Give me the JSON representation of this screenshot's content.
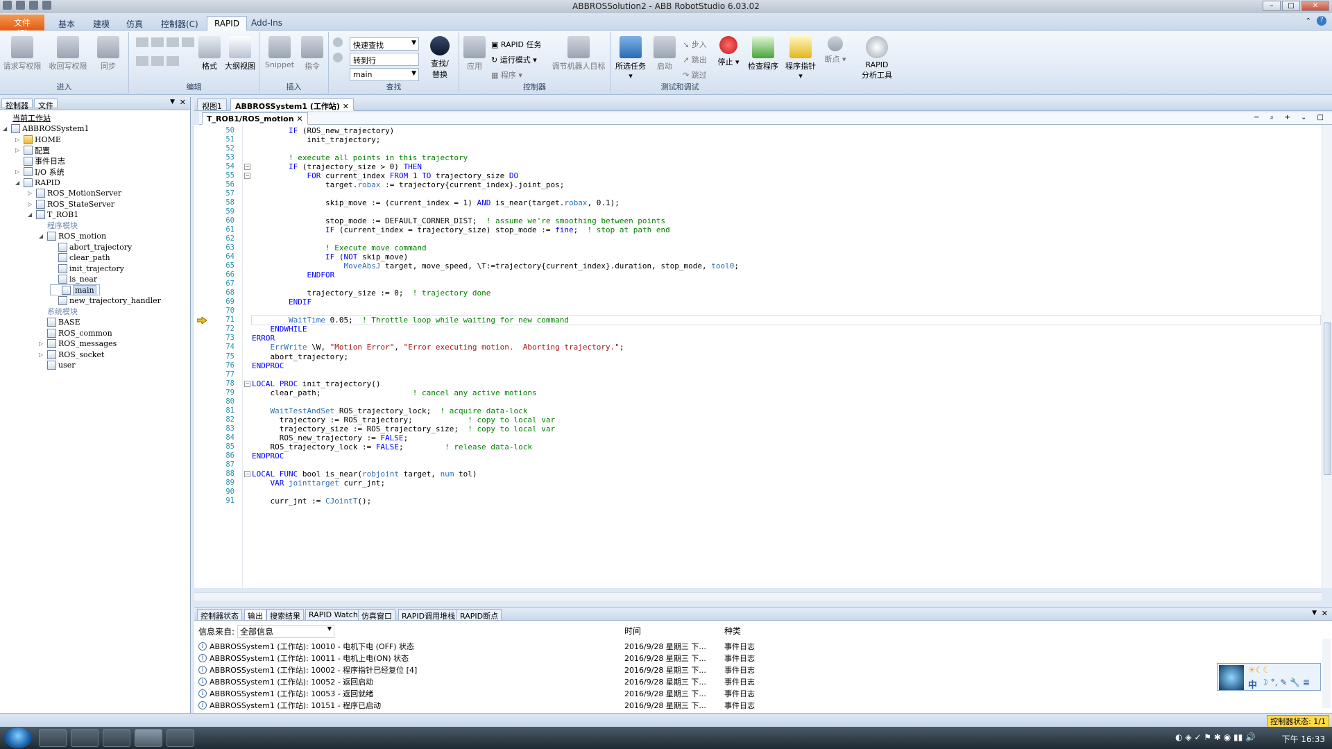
{
  "window": {
    "title": "ABBROSSolution2 - ABB RobotStudio 6.03.02"
  },
  "ribbon_tabs": [
    "文件 (F)",
    "基本",
    "建模",
    "仿真",
    "控制器(C)",
    "RAPID",
    "Add-Ins"
  ],
  "ribbon": {
    "access": {
      "label": "进入",
      "request": "请求写权限",
      "release": "收回写权限",
      "sync": "同步"
    },
    "edit": {
      "label": "编辑",
      "format": "格式",
      "outline": "大纲视图"
    },
    "insert": {
      "label": "插入",
      "snippet": "Snippet",
      "instruction": "指令"
    },
    "find": {
      "label": "查找",
      "quick_find": "快速查找",
      "goto_line": "转到行",
      "module_sel": "main",
      "find_replace": "查找/\n替换"
    },
    "controller": {
      "label": "控制器",
      "apply": "应用",
      "rapid_task": "RAPID 任务",
      "run_mode": "运行模式",
      "program": "程序",
      "tune_target": "调节机器人目标"
    },
    "test": {
      "label": "测试和调试",
      "all_tasks": "所选任务",
      "start": "启动",
      "step_in": "步入",
      "step_out": "跳出",
      "step_over": "跳过",
      "stop": "停止",
      "check": "检查程序",
      "pp": "程序指针",
      "breakpoint": "断点",
      "profiler": "RAPID\n分析工具"
    }
  },
  "left_panel": {
    "tabs": [
      "控制器",
      "文件"
    ],
    "tree": [
      {
        "label": "当前工作站",
        "level": 0,
        "kind": "header"
      },
      {
        "label": "ABBROSSystem1",
        "level": 0,
        "kind": "controller"
      },
      {
        "label": "HOME",
        "level": 1,
        "kind": "folder"
      },
      {
        "label": "配置",
        "level": 1,
        "kind": "config"
      },
      {
        "label": "事件日志",
        "level": 1,
        "kind": "log"
      },
      {
        "label": "I/O 系统",
        "level": 1,
        "kind": "io"
      },
      {
        "label": "RAPID",
        "level": 1,
        "kind": "rapid"
      },
      {
        "label": "ROS_MotionServer",
        "level": 2,
        "kind": "task"
      },
      {
        "label": "ROS_StateServer",
        "level": 2,
        "kind": "task"
      },
      {
        "label": "T_ROB1",
        "level": 2,
        "kind": "task"
      },
      {
        "label": "程序模块",
        "level": 3,
        "kind": "group"
      },
      {
        "label": "ROS_motion",
        "level": 3,
        "kind": "module"
      },
      {
        "label": "abort_trajectory",
        "level": 4,
        "kind": "proc"
      },
      {
        "label": "clear_path",
        "level": 4,
        "kind": "proc"
      },
      {
        "label": "init_trajectory",
        "level": 4,
        "kind": "proc"
      },
      {
        "label": "is_near",
        "level": 4,
        "kind": "func"
      },
      {
        "label": "main",
        "level": 4,
        "kind": "proc",
        "selected": true
      },
      {
        "label": "new_trajectory_handler",
        "level": 4,
        "kind": "proc"
      },
      {
        "label": "系统模块",
        "level": 3,
        "kind": "group"
      },
      {
        "label": "BASE",
        "level": 3,
        "kind": "sysmod"
      },
      {
        "label": "ROS_common",
        "level": 3,
        "kind": "sysmod"
      },
      {
        "label": "ROS_messages",
        "level": 3,
        "kind": "sysmod"
      },
      {
        "label": "ROS_socket",
        "level": 3,
        "kind": "sysmod"
      },
      {
        "label": "user",
        "level": 3,
        "kind": "sysmod"
      }
    ]
  },
  "doc_tabs": [
    "视图1",
    "ABBROSSystem1 (工作站)"
  ],
  "editor_tab": "T_ROB1/ROS_motion",
  "code": [
    {
      "n": "50",
      "t": "        IF (ROS_new_trajectory)"
    },
    {
      "n": "51",
      "t": "            init_trajectory;"
    },
    {
      "n": "52",
      "t": ""
    },
    {
      "n": "53",
      "t": "        ! execute all points in this trajectory"
    },
    {
      "n": "54",
      "t": "        IF (trajectory_size > 0) THEN"
    },
    {
      "n": "55",
      "t": "            FOR current_index FROM 1 TO trajectory_size DO"
    },
    {
      "n": "56",
      "t": "                target.robax := trajectory{current_index}.joint_pos;"
    },
    {
      "n": "57",
      "t": ""
    },
    {
      "n": "58",
      "t": "                skip_move := (current_index = 1) AND is_near(target.robax, 0.1);"
    },
    {
      "n": "59",
      "t": ""
    },
    {
      "n": "60",
      "t": "                stop_mode := DEFAULT_CORNER_DIST;  ! assume we're smoothing between points"
    },
    {
      "n": "61",
      "t": "                IF (current_index = trajectory_size) stop_mode := fine;  ! stop at path end"
    },
    {
      "n": "62",
      "t": ""
    },
    {
      "n": "63",
      "t": "                ! Execute move command"
    },
    {
      "n": "64",
      "t": "                IF (NOT skip_move)"
    },
    {
      "n": "65",
      "t": "                    MoveAbsJ target, move_speed, \\T:=trajectory{current_index}.duration, stop_mode, tool0;"
    },
    {
      "n": "66",
      "t": "            ENDFOR"
    },
    {
      "n": "67",
      "t": ""
    },
    {
      "n": "68",
      "t": "            trajectory_size := 0;  ! trajectory done"
    },
    {
      "n": "69",
      "t": "        ENDIF"
    },
    {
      "n": "70",
      "t": ""
    },
    {
      "n": "71",
      "t": "        WaitTime 0.05;  ! Throttle loop while waiting for new command"
    },
    {
      "n": "72",
      "t": "    ENDWHILE"
    },
    {
      "n": "73",
      "t": "ERROR"
    },
    {
      "n": "74",
      "t": "    ErrWrite \\W, \"Motion Error\", \"Error executing motion.  Aborting trajectory.\";"
    },
    {
      "n": "75",
      "t": "    abort_trajectory;"
    },
    {
      "n": "76",
      "t": "ENDPROC"
    },
    {
      "n": "77",
      "t": ""
    },
    {
      "n": "78",
      "t": "LOCAL PROC init_trajectory()"
    },
    {
      "n": "79",
      "t": "    clear_path;                    ! cancel any active motions"
    },
    {
      "n": "80",
      "t": ""
    },
    {
      "n": "81",
      "t": "    WaitTestAndSet ROS_trajectory_lock;  ! acquire data-lock"
    },
    {
      "n": "82",
      "t": "      trajectory := ROS_trajectory;            ! copy to local var"
    },
    {
      "n": "83",
      "t": "      trajectory_size := ROS_trajectory_size;  ! copy to local var"
    },
    {
      "n": "84",
      "t": "      ROS_new_trajectory := FALSE;"
    },
    {
      "n": "85",
      "t": "    ROS_trajectory_lock := FALSE;         ! release data-lock"
    },
    {
      "n": "86",
      "t": "ENDPROC"
    },
    {
      "n": "87",
      "t": ""
    },
    {
      "n": "88",
      "t": "LOCAL FUNC bool is_near(robjoint target, num tol)"
    },
    {
      "n": "89",
      "t": "    VAR jointtarget curr_jnt;"
    },
    {
      "n": "90",
      "t": ""
    },
    {
      "n": "91",
      "t": "    curr_jnt := CJointT();"
    }
  ],
  "bottom": {
    "tabs": [
      "控制器状态",
      "输出",
      "搜索结果",
      "RAPID Watch",
      "仿真窗口",
      "RAPID调用堆栈",
      "RAPID断点"
    ],
    "filter_label": "信息来自:",
    "filter_value": "全部信息",
    "col_time": "时间",
    "col_type": "种类",
    "rows": [
      {
        "msg": "ABBROSSystem1 (工作站): 10010 - 电机下电 (OFF) 状态",
        "time": "2016/9/28 星期三 下...",
        "type": "事件日志"
      },
      {
        "msg": "ABBROSSystem1 (工作站): 10011 - 电机上电(ON) 状态",
        "time": "2016/9/28 星期三 下...",
        "type": "事件日志"
      },
      {
        "msg": "ABBROSSystem1 (工作站): 10002 - 程序指针已经复位 [4]",
        "time": "2016/9/28 星期三 下...",
        "type": "事件日志"
      },
      {
        "msg": "ABBROSSystem1 (工作站): 10052 - 返回启动",
        "time": "2016/9/28 星期三 下...",
        "type": "事件日志"
      },
      {
        "msg": "ABBROSSystem1 (工作站): 10053 - 返回就绪",
        "time": "2016/9/28 星期三 下...",
        "type": "事件日志"
      },
      {
        "msg": "ABBROSSystem1 (工作站): 10151 - 程序已启动",
        "time": "2016/9/28 星期三 下...",
        "type": "事件日志"
      }
    ]
  },
  "status": {
    "controller_state": "控制器状态: 1/1"
  },
  "taskbar": {
    "clock": "下午 16:33",
    "ime": "中"
  }
}
